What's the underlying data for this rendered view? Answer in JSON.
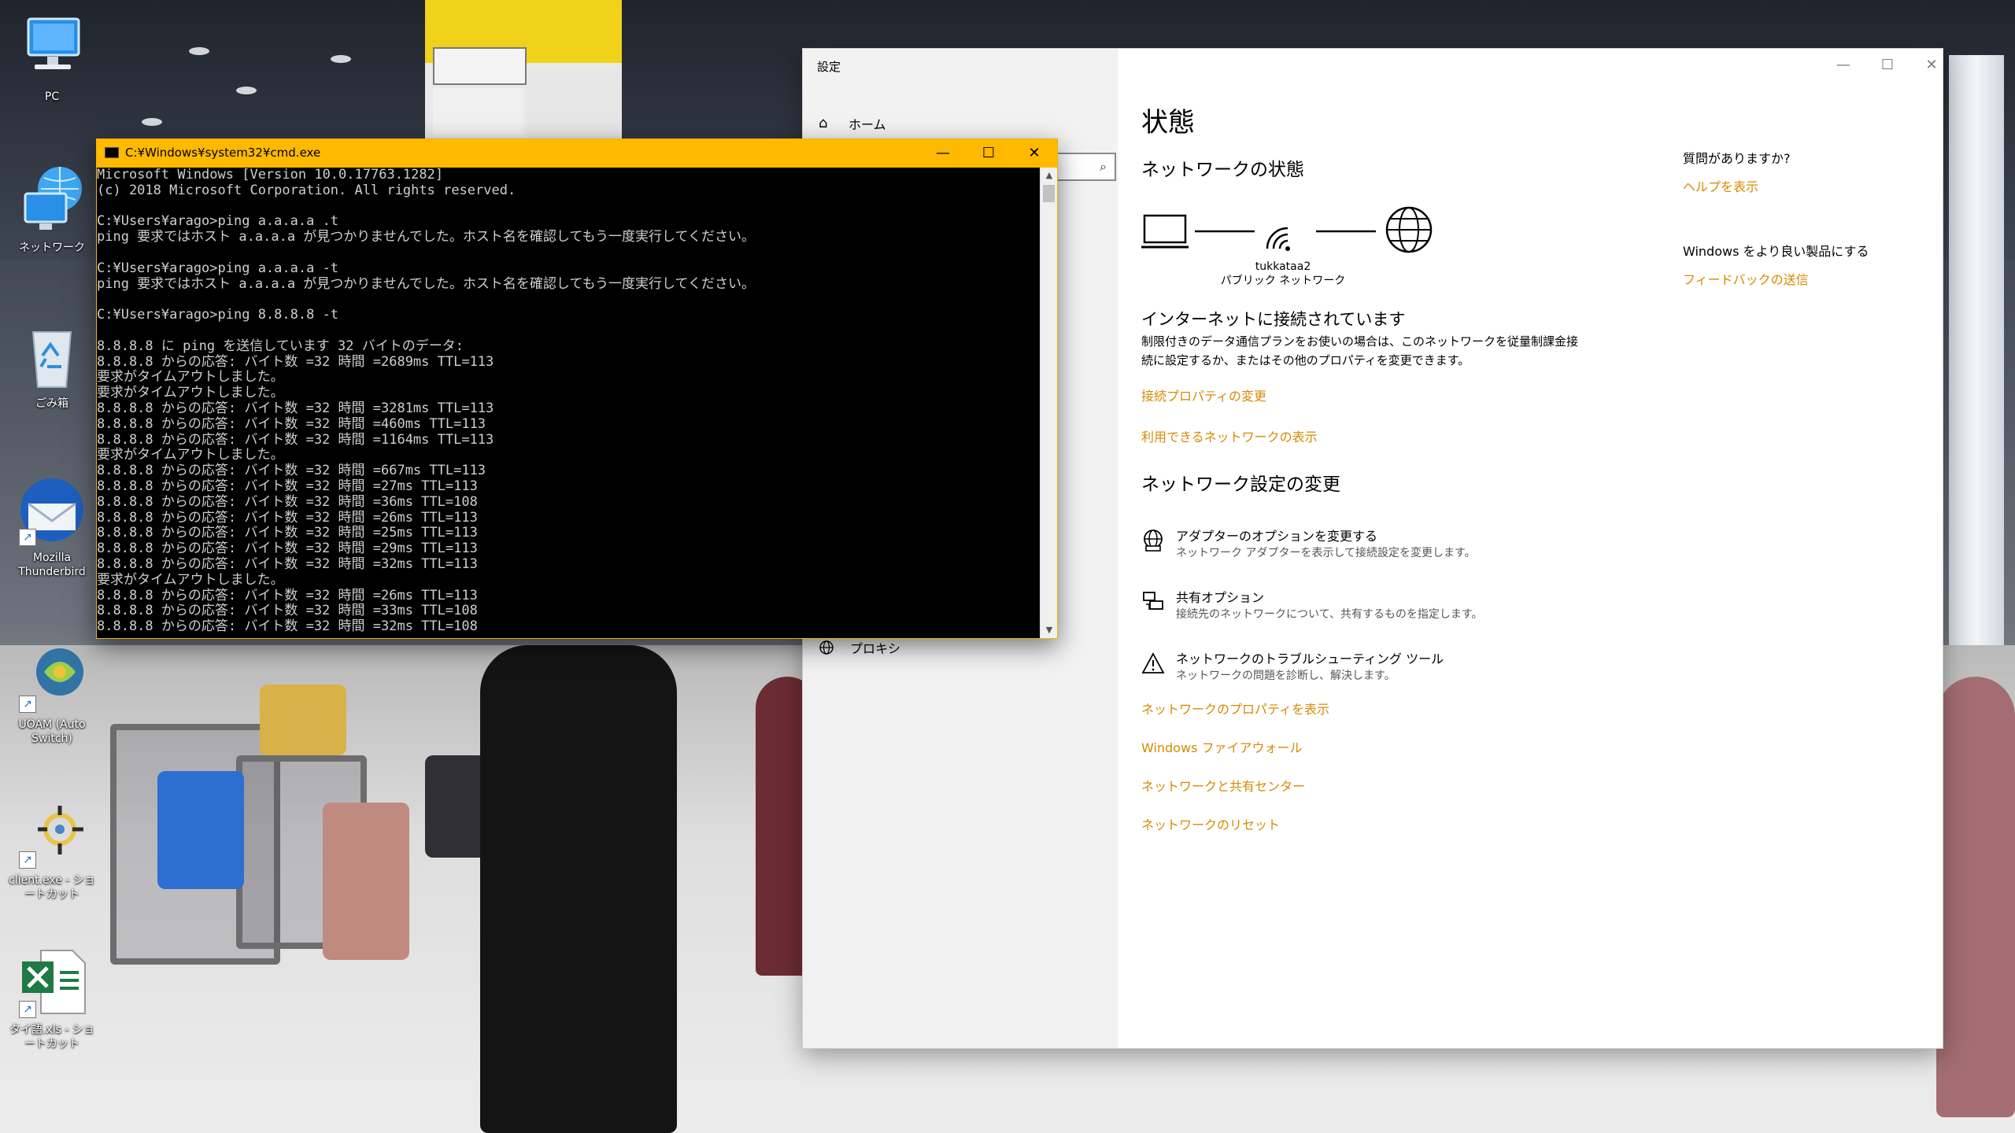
{
  "desktop": {
    "icons": [
      {
        "label": "PC",
        "icon": "computer-icon"
      },
      {
        "label": "ネットワーク",
        "icon": "network-icon"
      },
      {
        "label": "ごみ箱",
        "icon": "recycle-bin-icon"
      },
      {
        "label": "Mozilla Thunderbird",
        "icon": "thunderbird-icon"
      },
      {
        "label": "UOAM (Auto Switch)",
        "icon": "uoam-icon"
      },
      {
        "label": "client.exe - ショートカット",
        "icon": "client-exe-icon"
      },
      {
        "label": "タイ語.xls - ショートカット",
        "icon": "excel-icon"
      }
    ]
  },
  "settings": {
    "window_title": "設定",
    "home_label": "ホーム",
    "proxy_label": "プロキシ",
    "page_title": "状態",
    "network_status_heading": "ネットワークの状態",
    "network_name": "tukkataa2",
    "network_type": "パブリック ネットワーク",
    "connected_heading": "インターネットに接続されています",
    "connected_desc": "制限付きのデータ通信プランをお使いの場合は、このネットワークを従量制課金接続に設定するか、またはその他のプロパティを変更できます。",
    "link_change_props": "接続プロパティの変更",
    "link_show_networks": "利用できるネットワークの表示",
    "change_heading": "ネットワーク設定の変更",
    "options": [
      {
        "title": "アダプターのオプションを変更する",
        "desc": "ネットワーク アダプターを表示して接続設定を変更します。",
        "icon": "adapter-icon"
      },
      {
        "title": "共有オプション",
        "desc": "接続先のネットワークについて、共有するものを指定します。",
        "icon": "sharing-icon"
      },
      {
        "title": "ネットワークのトラブルシューティング ツール",
        "desc": "ネットワークの問題を診断し、解決します。",
        "icon": "warning-icon"
      }
    ],
    "links": [
      "ネットワークのプロパティを表示",
      "Windows ファイアウォール",
      "ネットワークと共有センター",
      "ネットワークのリセット"
    ],
    "aside": {
      "question": "質問がありますか?",
      "help_link": "ヘルプを表示",
      "improve": "Windows をより良い製品にする",
      "feedback_link": "フィードバックの送信"
    }
  },
  "cmd": {
    "title": "C:¥Windows¥system32¥cmd.exe",
    "lines": [
      "Microsoft Windows [Version 10.0.17763.1282]",
      "(c) 2018 Microsoft Corporation. All rights reserved.",
      "",
      "C:¥Users¥arago>ping a.a.a.a .t",
      "ping 要求ではホスト a.a.a.a が見つかりませんでした。ホスト名を確認してもう一度実行してください。",
      "",
      "C:¥Users¥arago>ping a.a.a.a -t",
      "ping 要求ではホスト a.a.a.a が見つかりませんでした。ホスト名を確認してもう一度実行してください。",
      "",
      "C:¥Users¥arago>ping 8.8.8.8 -t",
      "",
      "8.8.8.8 に ping を送信しています 32 バイトのデータ:",
      "8.8.8.8 からの応答: バイト数 =32 時間 =2689ms TTL=113",
      "要求がタイムアウトしました。",
      "要求がタイムアウトしました。",
      "8.8.8.8 からの応答: バイト数 =32 時間 =3281ms TTL=113",
      "8.8.8.8 からの応答: バイト数 =32 時間 =460ms TTL=113",
      "8.8.8.8 からの応答: バイト数 =32 時間 =1164ms TTL=113",
      "要求がタイムアウトしました。",
      "8.8.8.8 からの応答: バイト数 =32 時間 =667ms TTL=113",
      "8.8.8.8 からの応答: バイト数 =32 時間 =27ms TTL=113",
      "8.8.8.8 からの応答: バイト数 =32 時間 =36ms TTL=108",
      "8.8.8.8 からの応答: バイト数 =32 時間 =26ms TTL=113",
      "8.8.8.8 からの応答: バイト数 =32 時間 =25ms TTL=113",
      "8.8.8.8 からの応答: バイト数 =32 時間 =29ms TTL=113",
      "8.8.8.8 からの応答: バイト数 =32 時間 =32ms TTL=113",
      "要求がタイムアウトしました。",
      "8.8.8.8 からの応答: バイト数 =32 時間 =26ms TTL=113",
      "8.8.8.8 からの応答: バイト数 =32 時間 =33ms TTL=108",
      "8.8.8.8 からの応答: バイト数 =32 時間 =32ms TTL=108"
    ]
  },
  "colors": {
    "accent": "#d68a00",
    "cmd_titlebar": "#ffb900",
    "console_text": "#cfcfcf"
  }
}
